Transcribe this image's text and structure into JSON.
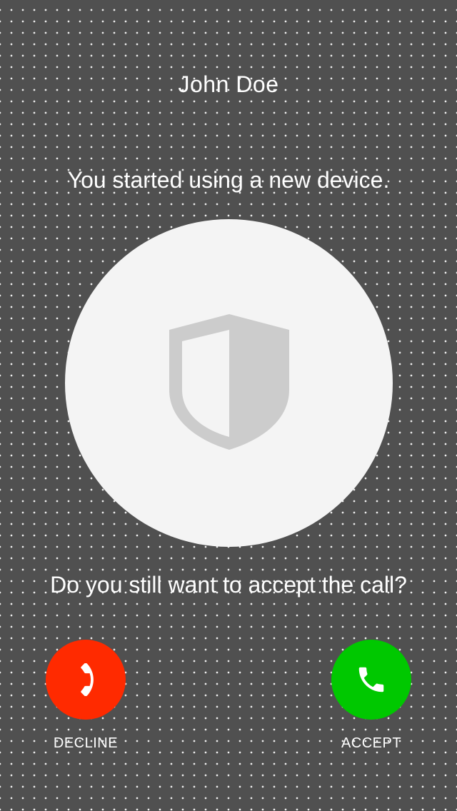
{
  "call": {
    "caller_name": "John Doe",
    "message": "You started using a new device.",
    "question": "Do you still want to accept the call?"
  },
  "icons": {
    "center": "shield-icon",
    "decline": "phone-hangup-icon",
    "accept": "phone-icon"
  },
  "actions": {
    "decline_label": "DECLINE",
    "accept_label": "ACCEPT"
  },
  "colors": {
    "background": "#505050",
    "decline": "#ff2a00",
    "accept": "#00c800",
    "circle": "#f4f4f4",
    "shield": "#cccccc"
  }
}
